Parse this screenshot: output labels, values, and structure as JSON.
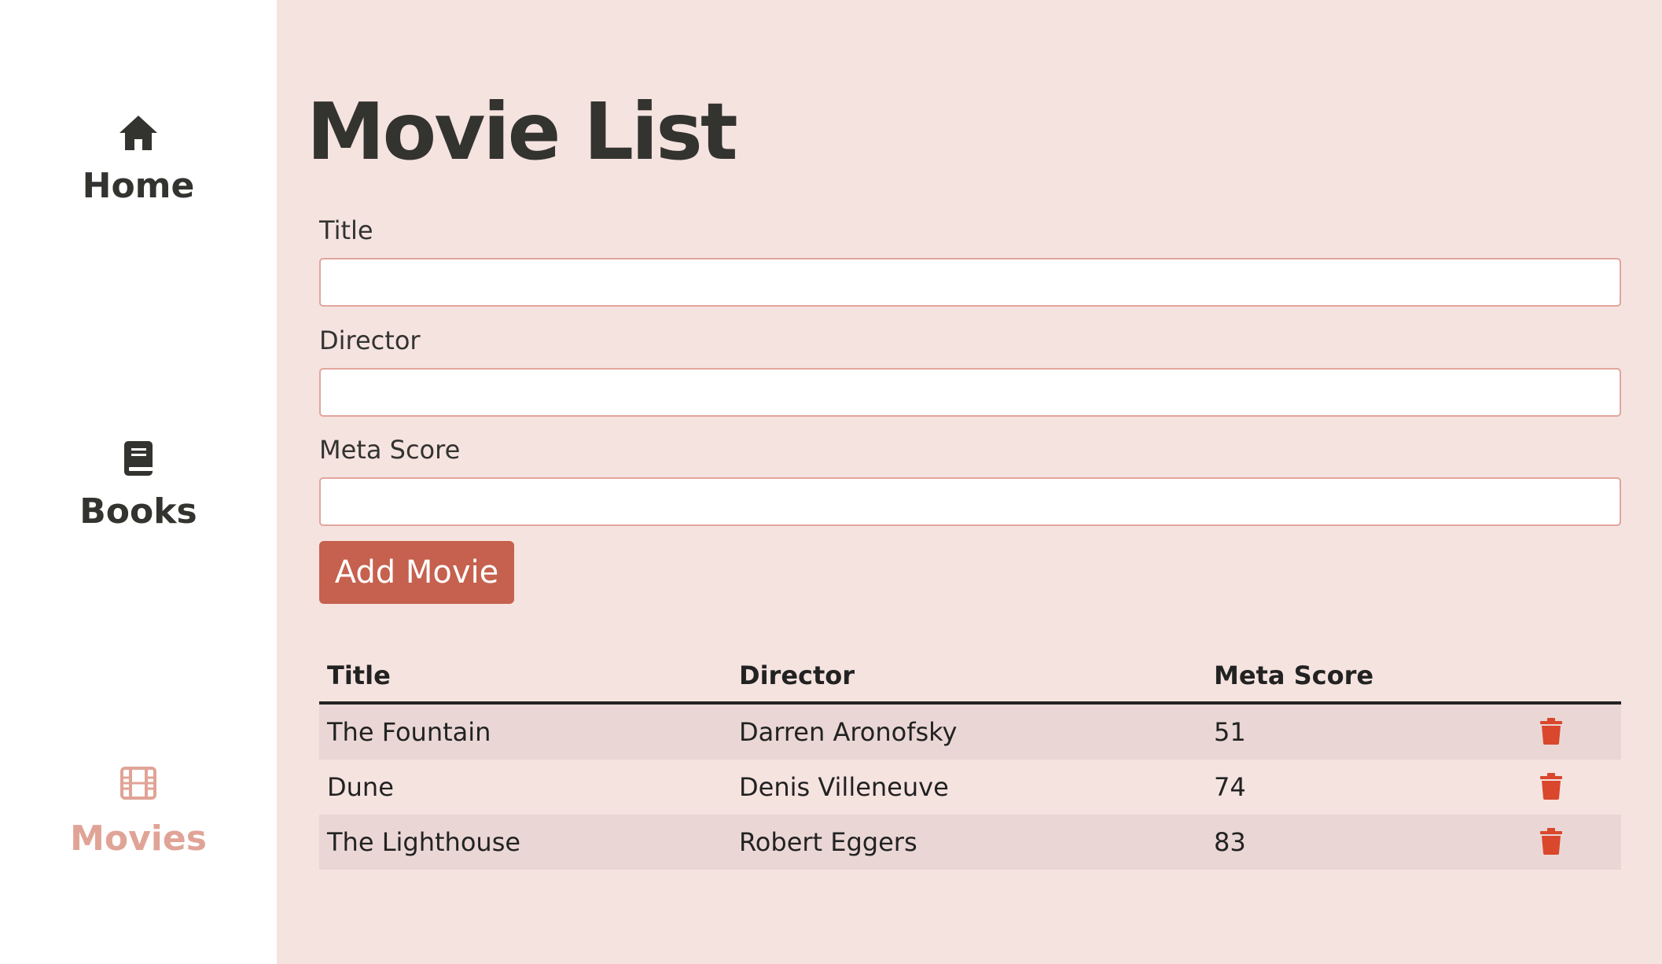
{
  "sidebar": {
    "items": [
      {
        "label": "Home",
        "icon": "home-icon",
        "active": false
      },
      {
        "label": "Books",
        "icon": "book-icon",
        "active": false
      },
      {
        "label": "Movies",
        "icon": "film-icon",
        "active": true
      }
    ]
  },
  "page": {
    "title": "Movie List"
  },
  "form": {
    "title_label": "Title",
    "title_value": "",
    "director_label": "Director",
    "director_value": "",
    "meta_label": "Meta Score",
    "meta_value": "",
    "submit_label": "Add Movie"
  },
  "table": {
    "columns": [
      "Title",
      "Director",
      "Meta Score"
    ],
    "rows": [
      {
        "title": "The Fountain",
        "director": "Darren Aronofsky",
        "score": "51"
      },
      {
        "title": "Dune",
        "director": "Denis Villeneuve",
        "score": "74"
      },
      {
        "title": "The Lighthouse",
        "director": "Robert Eggers",
        "score": "83"
      }
    ],
    "delete_icon": "trash-icon"
  },
  "colors": {
    "sidebar_bg": "#ffffff",
    "main_bg": "#f5e3e0",
    "accent": "#c5614e",
    "active_nav": "#e0a497",
    "input_border": "#e2a59b",
    "delete_icon": "#d9472c",
    "row_stripe": "#ead7d5"
  }
}
